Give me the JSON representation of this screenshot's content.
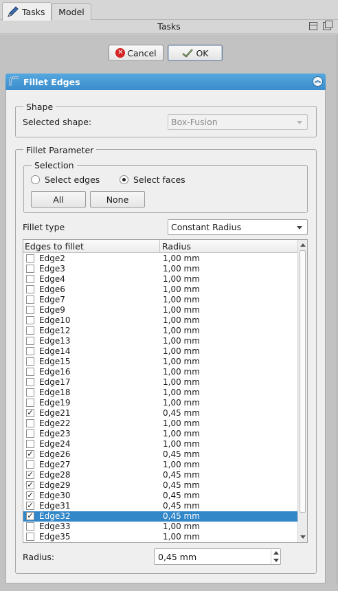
{
  "tabs": [
    {
      "label": "Tasks",
      "icon": "pencil-icon",
      "active": true
    },
    {
      "label": "Model",
      "active": false
    }
  ],
  "header": {
    "title": "Tasks"
  },
  "dialog_buttons": {
    "cancel_label": "Cancel",
    "ok_label": "OK"
  },
  "panel": {
    "title": "Fillet Edges",
    "icon": "fillet-icon"
  },
  "shape_group": {
    "title": "Shape",
    "selected_shape_label": "Selected shape:",
    "selected_shape_value": "Box-Fusion"
  },
  "fillet_parameter": {
    "title": "Fillet Parameter",
    "selection": {
      "title": "Selection",
      "select_edges_label": "Select edges",
      "select_faces_label": "Select faces",
      "selected_mode": "faces",
      "all_label": "All",
      "none_label": "None"
    },
    "fillet_type_label": "Fillet type",
    "fillet_type_value": "Constant Radius",
    "table": {
      "headers": [
        "Edges to fillet",
        "Radius"
      ],
      "rows": [
        {
          "name": "Edge2",
          "radius": "1,00 mm",
          "checked": false
        },
        {
          "name": "Edge3",
          "radius": "1,00 mm",
          "checked": false
        },
        {
          "name": "Edge4",
          "radius": "1,00 mm",
          "checked": false
        },
        {
          "name": "Edge6",
          "radius": "1,00 mm",
          "checked": false
        },
        {
          "name": "Edge7",
          "radius": "1,00 mm",
          "checked": false
        },
        {
          "name": "Edge9",
          "radius": "1,00 mm",
          "checked": false
        },
        {
          "name": "Edge10",
          "radius": "1,00 mm",
          "checked": false
        },
        {
          "name": "Edge12",
          "radius": "1,00 mm",
          "checked": false
        },
        {
          "name": "Edge13",
          "radius": "1,00 mm",
          "checked": false
        },
        {
          "name": "Edge14",
          "radius": "1,00 mm",
          "checked": false
        },
        {
          "name": "Edge15",
          "radius": "1,00 mm",
          "checked": false
        },
        {
          "name": "Edge16",
          "radius": "1,00 mm",
          "checked": false
        },
        {
          "name": "Edge17",
          "radius": "1,00 mm",
          "checked": false
        },
        {
          "name": "Edge18",
          "radius": "1,00 mm",
          "checked": false
        },
        {
          "name": "Edge19",
          "radius": "1,00 mm",
          "checked": false
        },
        {
          "name": "Edge21",
          "radius": "0,45 mm",
          "checked": true
        },
        {
          "name": "Edge22",
          "radius": "1,00 mm",
          "checked": false
        },
        {
          "name": "Edge23",
          "radius": "1,00 mm",
          "checked": false
        },
        {
          "name": "Edge24",
          "radius": "1,00 mm",
          "checked": false
        },
        {
          "name": "Edge26",
          "radius": "0,45 mm",
          "checked": true
        },
        {
          "name": "Edge27",
          "radius": "1,00 mm",
          "checked": false
        },
        {
          "name": "Edge28",
          "radius": "0,45 mm",
          "checked": true
        },
        {
          "name": "Edge29",
          "radius": "0,45 mm",
          "checked": true
        },
        {
          "name": "Edge30",
          "radius": "0,45 mm",
          "checked": true
        },
        {
          "name": "Edge31",
          "radius": "0,45 mm",
          "checked": true
        },
        {
          "name": "Edge32",
          "radius": "0,45 mm",
          "checked": true,
          "selected": true
        },
        {
          "name": "Edge33",
          "radius": "1,00 mm",
          "checked": false
        },
        {
          "name": "Edge35",
          "radius": "1,00 mm",
          "checked": false
        }
      ]
    },
    "radius_label": "Radius:",
    "radius_value": "0,45 mm"
  },
  "colors": {
    "panel_header": "#3a8ccc",
    "selection": "#3287c9",
    "cancel_icon": "#d42424"
  }
}
